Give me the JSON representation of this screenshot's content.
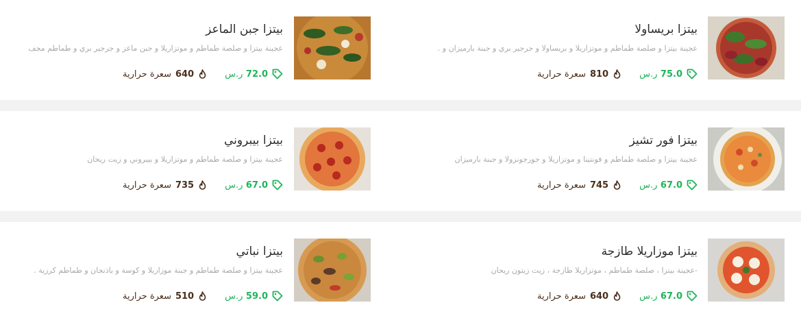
{
  "currency": "ر.س",
  "calorie_unit": "سعرة حرارية",
  "items": [
    {
      "name": "بيتزا بريساولا",
      "description": "عجينة بيتزا و صلصة طماطم و موتزاريلا و بريساولا و جرجير بري و جبنة بارميزان و .",
      "price": "75.0",
      "calories": "810"
    },
    {
      "name": "بيتزا جبن الماعز",
      "description": "عجينة بيتزا و صلصة طماطم و موتزاريلا و جبن ماعز و جرجير بري و طماطم مجف",
      "price": "72.0",
      "calories": "640"
    },
    {
      "name": "بيتزا فور تشيز",
      "description": "عجينة بيتزا و صلصة طماطم و فونتينا و موتزاريلا و جورجونزولا و جبنة بارميزان",
      "price": "67.0",
      "calories": "745"
    },
    {
      "name": "بيتزا بيبروني",
      "description": "عجينة بيتزا و صلصة طماطم و موتزاريلا و بيبروني و زيت ريحان",
      "price": "67.0",
      "calories": "735"
    },
    {
      "name": "بيتزا موزاريلا طازجة",
      "description": "-عجينة بيتزا ، صلصة طماطم ، موتزاريلا طازجة ، زيت زيتون ريحان",
      "price": "67.0",
      "calories": "640"
    },
    {
      "name": "بيتزا نباتي",
      "description": "عجينة بيتزا و صلصة طماطم و جبنة موزاريلا و كوسة و باذنجان و طماطم كرزية .",
      "price": "59.0",
      "calories": "510"
    }
  ],
  "colors": {
    "price": "#1fb45a",
    "calories": "#4a2e1c",
    "title": "#2c2c2c",
    "description": "#a9a9a9"
  },
  "icons": {
    "price": "price-tag-icon",
    "calories": "flame-icon"
  }
}
